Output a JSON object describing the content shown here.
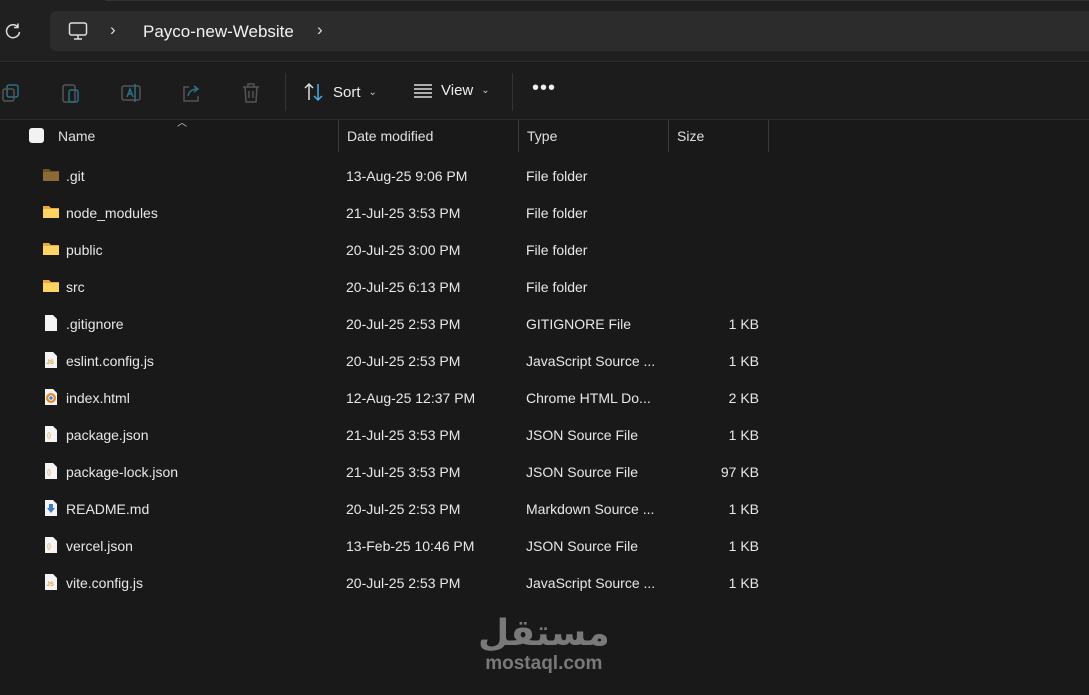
{
  "address": {
    "crumbs": [
      "Payco-new-Website"
    ]
  },
  "toolbar": {
    "sort": "Sort",
    "view": "View"
  },
  "columns": {
    "name": "Name",
    "date": "Date modified",
    "type": "Type",
    "size": "Size"
  },
  "files": [
    {
      "name": ".git",
      "date": "13-Aug-25 9:06 PM",
      "type": "File folder",
      "size": "",
      "icon": "folder-dark"
    },
    {
      "name": "node_modules",
      "date": "21-Jul-25 3:53 PM",
      "type": "File folder",
      "size": "",
      "icon": "folder"
    },
    {
      "name": "public",
      "date": "20-Jul-25 3:00 PM",
      "type": "File folder",
      "size": "",
      "icon": "folder"
    },
    {
      "name": "src",
      "date": "20-Jul-25 6:13 PM",
      "type": "File folder",
      "size": "",
      "icon": "folder"
    },
    {
      "name": ".gitignore",
      "date": "20-Jul-25 2:53 PM",
      "type": "GITIGNORE File",
      "size": "1 KB",
      "icon": "file"
    },
    {
      "name": "eslint.config.js",
      "date": "20-Jul-25 2:53 PM",
      "type": "JavaScript Source ...",
      "size": "1 KB",
      "icon": "js"
    },
    {
      "name": "index.html",
      "date": "12-Aug-25 12:37 PM",
      "type": "Chrome HTML Do...",
      "size": "2 KB",
      "icon": "chrome"
    },
    {
      "name": "package.json",
      "date": "21-Jul-25 3:53 PM",
      "type": "JSON Source File",
      "size": "1 KB",
      "icon": "json"
    },
    {
      "name": "package-lock.json",
      "date": "21-Jul-25 3:53 PM",
      "type": "JSON Source File",
      "size": "97 KB",
      "icon": "json"
    },
    {
      "name": "README.md",
      "date": "20-Jul-25 2:53 PM",
      "type": "Markdown Source ...",
      "size": "1 KB",
      "icon": "md"
    },
    {
      "name": "vercel.json",
      "date": "13-Feb-25 10:46 PM",
      "type": "JSON Source File",
      "size": "1 KB",
      "icon": "json"
    },
    {
      "name": "vite.config.js",
      "date": "20-Jul-25 2:53 PM",
      "type": "JavaScript Source ...",
      "size": "1 KB",
      "icon": "js"
    }
  ],
  "watermark": {
    "arabic": "مستقل",
    "latin": "mostaql.com"
  }
}
